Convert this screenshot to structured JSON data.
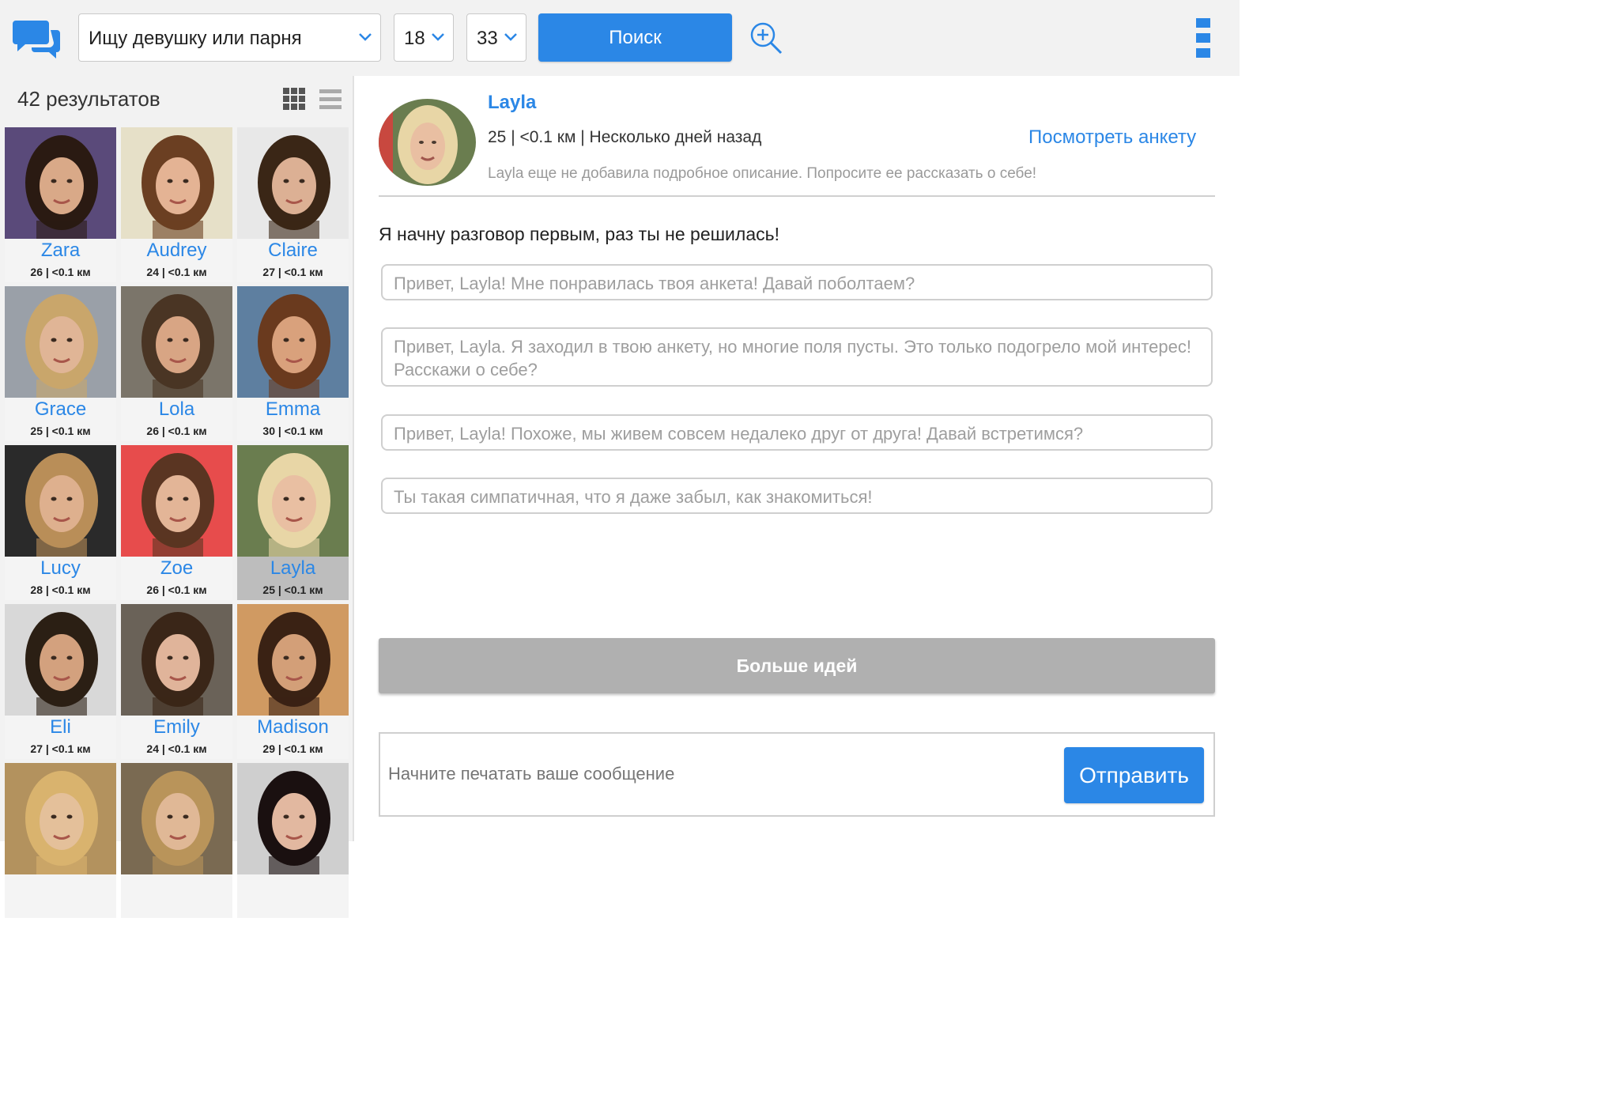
{
  "app": {
    "logo_icon": "chat-bubbles-icon",
    "accent_color": "#2b87e6"
  },
  "search": {
    "gender_value": "Ищу девушку или парня",
    "age_min": "18",
    "age_max": "33",
    "search_label": "Поиск",
    "zoom_icon": "zoom-in-icon",
    "menu_icon": "vertical-menu-icon"
  },
  "results": {
    "count_label": "42 результатов",
    "grid_icon": "grid-view-icon",
    "list_icon": "list-view-icon"
  },
  "profiles": [
    {
      "name": "Zara",
      "meta": "26 | <0.1 км"
    },
    {
      "name": "Audrey",
      "meta": "24 | <0.1 км"
    },
    {
      "name": "Claire",
      "meta": "27 | <0.1 км"
    },
    {
      "name": "Grace",
      "meta": "25 | <0.1 км"
    },
    {
      "name": "Lola",
      "meta": "26 | <0.1 км"
    },
    {
      "name": "Emma",
      "meta": "30 | <0.1 км"
    },
    {
      "name": "Lucy",
      "meta": "28 | <0.1 км"
    },
    {
      "name": "Zoe",
      "meta": "26 | <0.1 км"
    },
    {
      "name": "Layla",
      "meta": "25 | <0.1 км",
      "selected": true
    },
    {
      "name": "Eli",
      "meta": "27 | <0.1 км"
    },
    {
      "name": "Emily",
      "meta": "24 | <0.1 км"
    },
    {
      "name": "Madison",
      "meta": "29 | <0.1 км"
    },
    {
      "name": "",
      "meta": ""
    },
    {
      "name": "",
      "meta": ""
    },
    {
      "name": "",
      "meta": ""
    }
  ],
  "chat": {
    "name": "Layla",
    "meta": "25 | <0.1 км | Несколько дней назад",
    "view_profile": "Посмотреть анкету",
    "description": "Layla еще не добавила подробное описание. Попросите ее рассказать о себе!",
    "prompt": "Я начну разговор первым, раз ты не решилась!",
    "ideas": [
      "Привет, Layla! Мне понравилась твоя анкета! Давай поболтаем?",
      "Привет, Layla. Я заходил в твою анкету, но многие поля пусты. Это только подогрело мой интерес! Расскажи о себе?",
      "Привет, Layla! Похоже, мы живем совсем недалеко друг от друга! Давай встретимся?",
      "Ты такая симпатичная, что я даже забыл, как знакомиться!"
    ],
    "more_ideas": "Больше идей",
    "input_placeholder": "Начните печатать ваше сообщение",
    "send_label": "Отправить"
  }
}
